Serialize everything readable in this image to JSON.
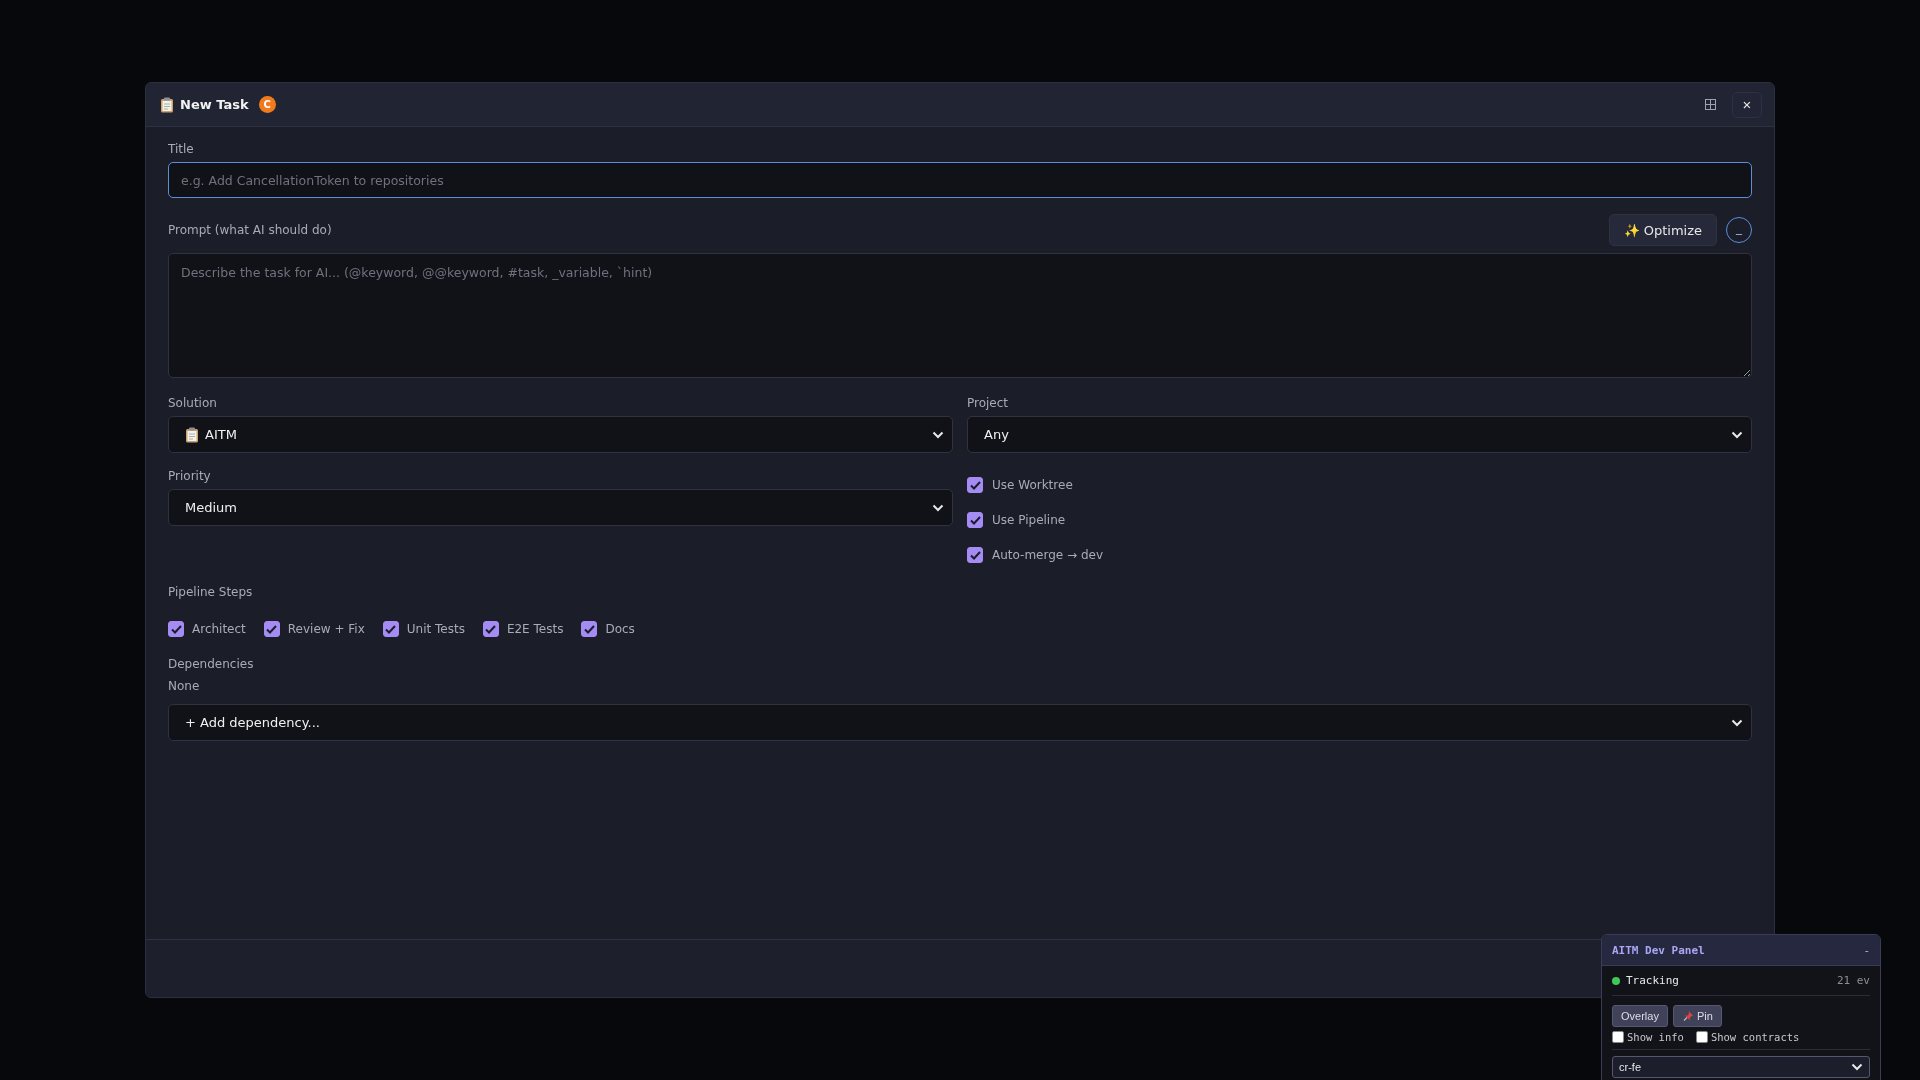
{
  "dialog": {
    "title": "New Task",
    "badge": "C",
    "close": "×"
  },
  "title_field": {
    "label": "Title",
    "placeholder": "e.g. Add CancellationToken to repositories"
  },
  "prompt_field": {
    "label": "Prompt (what AI should do)",
    "placeholder": "Describe the task for AI... (@keyword, @@keyword, #task, _variable, `hint)",
    "optimize_button": "✨ Optimize",
    "side_button": "_"
  },
  "solution": {
    "label": "Solution",
    "value": "AITM"
  },
  "project": {
    "label": "Project",
    "value": "Any"
  },
  "priority": {
    "label": "Priority",
    "value": "Medium"
  },
  "options": [
    {
      "label": "Use Worktree",
      "checked": true
    },
    {
      "label": "Use Pipeline",
      "checked": true
    },
    {
      "label": "Auto-merge → dev",
      "checked": true
    }
  ],
  "pipeline_steps": {
    "label": "Pipeline Steps",
    "steps": [
      {
        "label": "Architect",
        "checked": true
      },
      {
        "label": "Review + Fix",
        "checked": true
      },
      {
        "label": "Unit Tests",
        "checked": true
      },
      {
        "label": "E2E Tests",
        "checked": true
      },
      {
        "label": "Docs",
        "checked": true
      }
    ]
  },
  "dependencies": {
    "label": "Dependencies",
    "value": "None",
    "select": "+ Add dependency..."
  },
  "dev_panel": {
    "title": "AITM Dev Panel",
    "collapse": "-",
    "status": {
      "label": "Tracking",
      "active": true,
      "count": "21 ev"
    },
    "buttons": [
      {
        "label": "Overlay",
        "kind": "plain"
      },
      {
        "label": "Pin",
        "kind": "pin"
      }
    ],
    "toggles": [
      {
        "label": "Show info",
        "checked": false
      },
      {
        "label": "Show contracts",
        "checked": false
      }
    ],
    "select": "cr-fe"
  }
}
